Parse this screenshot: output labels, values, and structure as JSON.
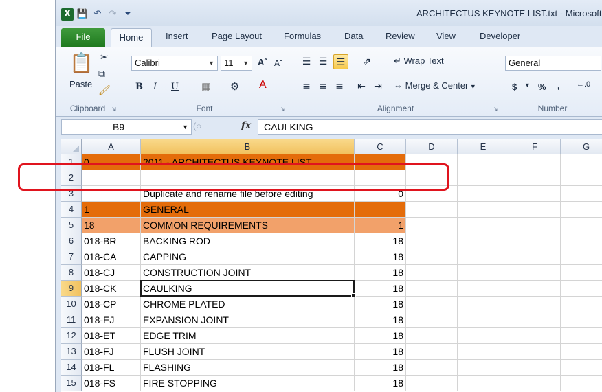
{
  "window": {
    "title": "ARCHITECTUS KEYNOTE LIST.txt - Microsoft Excel",
    "app_icon": "excel-icon"
  },
  "qat": {
    "save": "save-icon",
    "undo": "undo-icon",
    "redo": "redo-icon",
    "customize": "customize-qat-icon"
  },
  "tabs": [
    "File",
    "Home",
    "Insert",
    "Page Layout",
    "Formulas",
    "Data",
    "Review",
    "View",
    "Developer"
  ],
  "active_tab": "Home",
  "ribbon": {
    "clipboard": {
      "label": "Clipboard",
      "paste": "Paste"
    },
    "font": {
      "label": "Font",
      "family": "Calibri",
      "size": "11",
      "bold": "B",
      "italic": "I",
      "underline": "U"
    },
    "alignment": {
      "label": "Alignment",
      "wrap_text": "Wrap Text",
      "merge_center": "Merge & Center"
    },
    "number": {
      "label": "Number",
      "format": "General",
      "currency": "$",
      "percent": "%",
      "comma": ","
    }
  },
  "formula_bar": {
    "name_box": "B9",
    "fx": "fx",
    "value": "CAULKING"
  },
  "columns": [
    "A",
    "B",
    "C",
    "D",
    "E",
    "F",
    "G"
  ],
  "active_column": "B",
  "active_row": "9",
  "rows": [
    {
      "num": "1",
      "a": "0",
      "b": "2011 - ARCHITECTUS KEYNOTE LIST",
      "c": "",
      "fill": "#e46c0a"
    },
    {
      "num": "2",
      "a": "",
      "b": "",
      "c": "",
      "fill": ""
    },
    {
      "num": "3",
      "a": "",
      "b": "Duplicate and rename file before editing",
      "c": "0",
      "fill": ""
    },
    {
      "num": "4",
      "a": "1",
      "b": "GENERAL",
      "c": "",
      "fill": "#e46c0a"
    },
    {
      "num": "5",
      "a": "18",
      "b": "COMMON REQUIREMENTS",
      "c": "1",
      "fill": "#f2a16a"
    },
    {
      "num": "6",
      "a": "018-BR",
      "b": "BACKING ROD",
      "c": "18",
      "fill": ""
    },
    {
      "num": "7",
      "a": "018-CA",
      "b": "CAPPING",
      "c": "18",
      "fill": ""
    },
    {
      "num": "8",
      "a": "018-CJ",
      "b": "CONSTRUCTION JOINT",
      "c": "18",
      "fill": ""
    },
    {
      "num": "9",
      "a": "018-CK",
      "b": "CAULKING",
      "c": "18",
      "fill": ""
    },
    {
      "num": "10",
      "a": "018-CP",
      "b": "CHROME PLATED",
      "c": "18",
      "fill": ""
    },
    {
      "num": "11",
      "a": "018-EJ",
      "b": "EXPANSION JOINT",
      "c": "18",
      "fill": ""
    },
    {
      "num": "12",
      "a": "018-ET",
      "b": "EDGE TRIM",
      "c": "18",
      "fill": ""
    },
    {
      "num": "13",
      "a": "018-FJ",
      "b": "FLUSH JOINT",
      "c": "18",
      "fill": ""
    },
    {
      "num": "14",
      "a": "018-FL",
      "b": "FLASHING",
      "c": "18",
      "fill": ""
    },
    {
      "num": "15",
      "a": "018-FS",
      "b": "FIRE STOPPING",
      "c": "18",
      "fill": ""
    }
  ],
  "highlight_color": "#e0141e"
}
